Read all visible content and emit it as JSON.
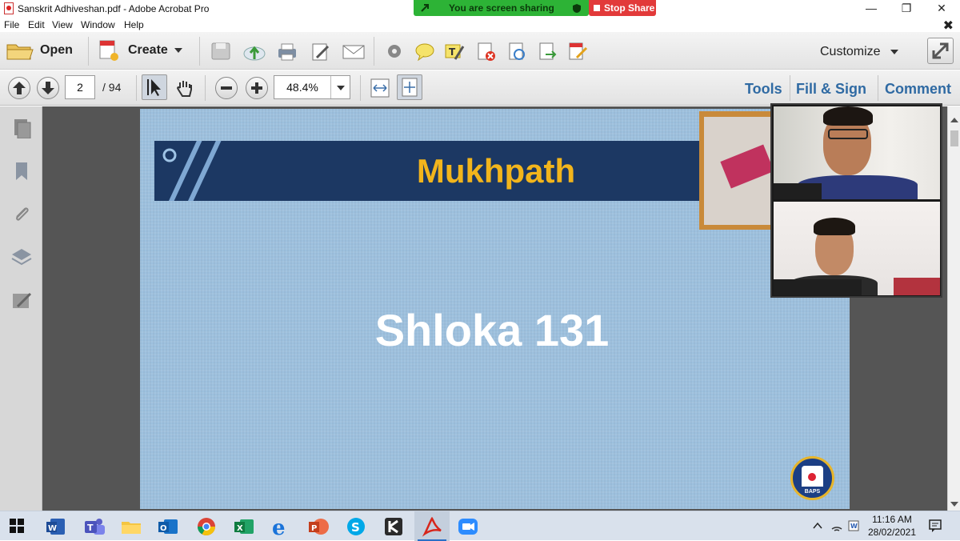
{
  "window": {
    "title": "Sanskrit Adhiveshan.pdf - Adobe Acrobat Pro",
    "minimize": "—",
    "restore": "❐",
    "close": "✕"
  },
  "share": {
    "status": "You are screen sharing",
    "stop_label": "Stop Share",
    "banner_color": "#2db336",
    "stop_color": "#e23a3a"
  },
  "menu": {
    "items": [
      "File",
      "Edit",
      "View",
      "Window",
      "Help"
    ],
    "close_icon": "✖"
  },
  "toolbar": {
    "open_label": "Open",
    "create_label": "Create",
    "customize_label": "Customize"
  },
  "navbar": {
    "page_current": "2",
    "page_total": "/ 94",
    "zoom": "48.4%",
    "tools_label": "Tools",
    "fill_sign_label": "Fill & Sign",
    "comment_label": "Comment"
  },
  "slide": {
    "title": "Mukhpath",
    "subtitle": "Shloka 131",
    "logo_text": "BAPS"
  },
  "taskbar": {
    "apps": [
      "word-icon",
      "teams-icon",
      "file-explorer-icon",
      "outlook-icon",
      "chrome-icon",
      "excel-icon",
      "edge-icon",
      "powerpoint-icon",
      "skype-icon",
      "kodi-icon",
      "acrobat-icon",
      "zoom-icon"
    ],
    "time": "11:16 AM",
    "date": "28/02/2021"
  }
}
